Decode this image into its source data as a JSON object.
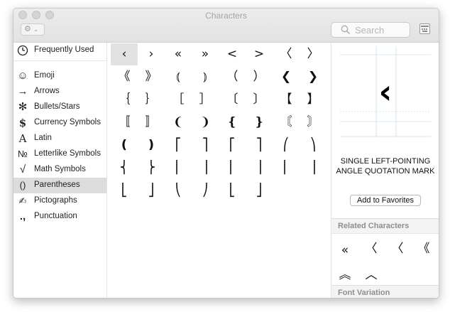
{
  "window": {
    "title": "Characters"
  },
  "toolbar": {
    "gear_symbol": "⚙",
    "chevron_symbol": "⌄",
    "search_placeholder": "Search"
  },
  "sidebar": {
    "items": [
      {
        "label": "Frequently Used",
        "icon": "🕘",
        "icon_name": "clock-icon"
      },
      {
        "label": "Emoji",
        "icon": "☺",
        "icon_name": "smiley-icon"
      },
      {
        "label": "Arrows",
        "icon": "→",
        "icon_name": "arrow-icon"
      },
      {
        "label": "Bullets/Stars",
        "icon": "✻",
        "icon_name": "asterisk-icon"
      },
      {
        "label": "Currency Symbols",
        "icon": "$",
        "icon_name": "dollar-icon"
      },
      {
        "label": "Latin",
        "icon": "A",
        "icon_name": "latin-a-icon"
      },
      {
        "label": "Letterlike Symbols",
        "icon": "№",
        "icon_name": "numero-icon"
      },
      {
        "label": "Math Symbols",
        "icon": "√",
        "icon_name": "square-root-icon"
      },
      {
        "label": "Parentheses",
        "icon": "()",
        "icon_name": "parentheses-icon"
      },
      {
        "label": "Pictographs",
        "icon": "✍",
        "icon_name": "writing-hand-icon"
      },
      {
        "label": "Punctuation",
        "icon": ".,",
        "icon_name": "punctuation-icon"
      }
    ],
    "selected": "Parentheses"
  },
  "grid": {
    "rows": [
      [
        "‹",
        "›",
        "«",
        "»",
        "<",
        ">",
        "〈",
        "〉"
      ],
      [
        "《",
        "》",
        "⦅",
        "⦆",
        "（",
        "）",
        "❮",
        "❯"
      ],
      [
        "｛",
        "｝",
        "［",
        "］",
        "〔",
        "〕",
        "【",
        "】"
      ],
      [
        "〚",
        "〛",
        "❨",
        "❩",
        "❴",
        "❵",
        "〘",
        "〙"
      ],
      [
        "❪",
        "❫",
        "⎡",
        "⎤",
        "⎡",
        "⎤",
        "⎛",
        "⎞"
      ],
      [
        "⎨",
        "⎬",
        "⎢",
        "⎥",
        "⎢",
        "⎥",
        "⎜",
        "⎟"
      ],
      [
        "⎣",
        "⎦",
        "⎝",
        "⎠",
        "⎣",
        "⎦"
      ]
    ],
    "selected_glyph": "‹"
  },
  "detail": {
    "glyph": "‹",
    "name": "SINGLE LEFT-POINTING ANGLE QUOTATION MARK",
    "add_favorites_label": "Add to Favorites",
    "related_header": "Related Characters",
    "related": [
      "«",
      "〈",
      "〈",
      "《",
      "︽",
      "︿"
    ],
    "font_variation_header": "Font Variation"
  }
}
